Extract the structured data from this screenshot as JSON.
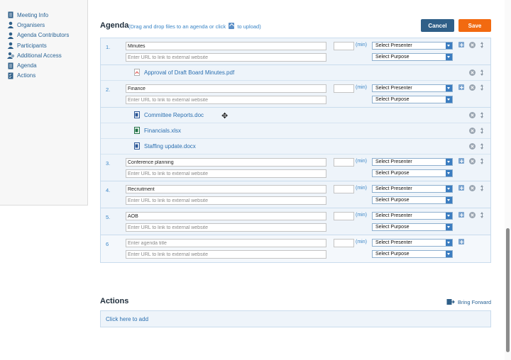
{
  "sidebar": {
    "items": [
      {
        "label": "Meeting Info",
        "icon": "document-icon"
      },
      {
        "label": "Organisers",
        "icon": "user-icon"
      },
      {
        "label": "Agenda Contributors",
        "icon": "user-icon"
      },
      {
        "label": "Participants",
        "icon": "user-icon"
      },
      {
        "label": "Additional Access",
        "icon": "user-key-icon"
      },
      {
        "label": "Agenda",
        "icon": "document-icon"
      },
      {
        "label": "Actions",
        "icon": "checklist-icon"
      }
    ]
  },
  "agenda": {
    "title": "Agenda",
    "hint_before": "(Drag and drop files to an agenda or click",
    "hint_after": "to upload)",
    "cancel_label": "Cancel",
    "save_label": "Save",
    "url_placeholder": "Enter URL to link to external website",
    "title_placeholder": "Enter agenda title",
    "min_label": "(min)",
    "presenter_default": "Select Presenter",
    "purpose_default": "Select Purpose",
    "items": [
      {
        "num": "1.",
        "title": "Minutes"
      },
      {
        "num": "2.",
        "title": "Finance"
      },
      {
        "num": "3.",
        "title": "Conference planning"
      },
      {
        "num": "4.",
        "title": "Recruitment"
      },
      {
        "num": "5.",
        "title": "AOB"
      },
      {
        "num": "6",
        "title": ""
      }
    ],
    "attachments": [
      {
        "name": "Approval of Draft Board Minutes.pdf",
        "type": "pdf"
      },
      {
        "name": "Committee Reports.doc",
        "type": "doc"
      },
      {
        "name": "Financials.xlsx",
        "type": "xlsx"
      },
      {
        "name": "Staffing update.docx",
        "type": "docx"
      }
    ]
  },
  "actions": {
    "title": "Actions",
    "bring_forward": "Bring Forward",
    "add_link": "Click here to add"
  },
  "colors": {
    "accent": "#2f5f88",
    "save": "#f26a10",
    "link": "#2a6fb0",
    "panel": "#eef4fa"
  }
}
